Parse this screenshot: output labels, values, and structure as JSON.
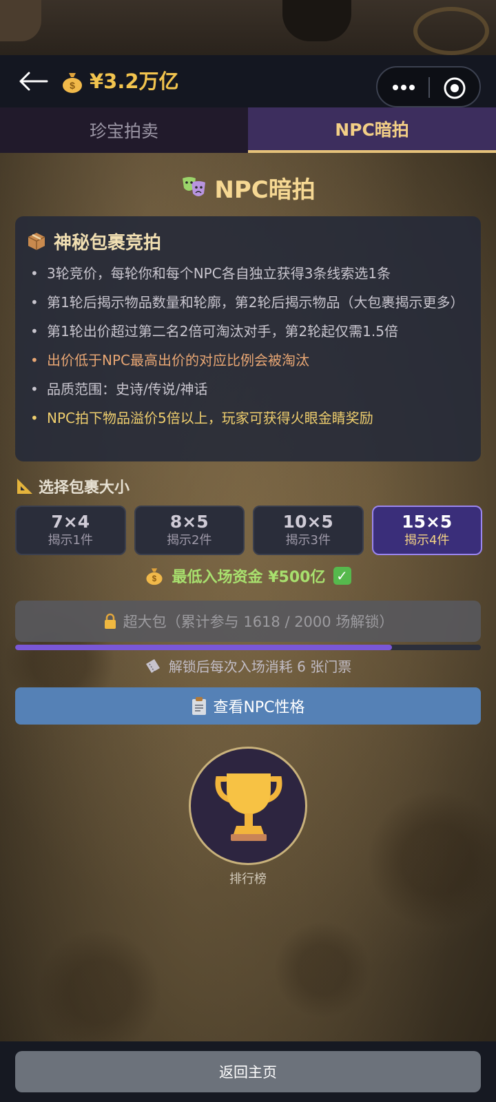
{
  "header": {
    "balance": "¥3.2万亿",
    "icons": {
      "back": "back-arrow-icon",
      "money": "money-bag-icon",
      "more": "more-dots-icon",
      "close": "target-circle-icon"
    }
  },
  "tabs": [
    {
      "label": "珍宝拍卖",
      "active": false
    },
    {
      "label": "NPC暗拍",
      "active": true
    }
  ],
  "page": {
    "title": "NPC暗拍",
    "title_icon": "theater-masks-icon"
  },
  "info_card": {
    "title": "神秘包裹竞拍",
    "title_icon": "package-icon",
    "rules": [
      {
        "text": "3轮竞价，每轮你和每个NPC各自独立获得3条线索选1条",
        "color": "#c9c6cf"
      },
      {
        "text": "第1轮后揭示物品数量和轮廓，第2轮后揭示物品（大包裹揭示更多）",
        "color": "#c9c6cf"
      },
      {
        "text": "第1轮出价超过第二名2倍可淘汰对手，第2轮起仅需1.5倍",
        "color": "#c9c6cf"
      },
      {
        "text": "出价低于NPC最高出价的对应比例会被淘汰",
        "color": "#e9a774"
      },
      {
        "text": "品质范围：史诗/传说/神话",
        "color": "#c9c6cf"
      },
      {
        "text": "NPC拍下物品溢价5倍以上，玩家可获得火眼金睛奖励",
        "color": "#f0cf6e"
      }
    ]
  },
  "size_selector": {
    "label": "选择包裹大小",
    "label_icon": "triangle-ruler-icon",
    "options": [
      {
        "size": "7×4",
        "reveal": "揭示1件",
        "selected": false
      },
      {
        "size": "8×5",
        "reveal": "揭示2件",
        "selected": false
      },
      {
        "size": "10×5",
        "reveal": "揭示3件",
        "selected": false
      },
      {
        "size": "15×5",
        "reveal": "揭示4件",
        "selected": true
      }
    ]
  },
  "min_fund": {
    "text": "最低入场资金 ¥500亿",
    "check": "✓"
  },
  "locked_package": {
    "text": "超大包（累计参与 1618 / 2000 场解锁）",
    "progress": 0.809
  },
  "ticket_note": "解锁后每次入场消耗 6 张门票",
  "npc_button": "查看NPC性格",
  "leaderboard": {
    "label": "排行榜",
    "icon": "trophy-icon"
  },
  "footer": {
    "home_button": "返回主页"
  },
  "colors": {
    "accent_gold": "#f2c44e",
    "tab_active_bg": "#3d2e5e",
    "selected_size_bg": "#3a2e7a",
    "npc_button_bg": "#5581b6",
    "progress_fill": "#7a57d6"
  }
}
